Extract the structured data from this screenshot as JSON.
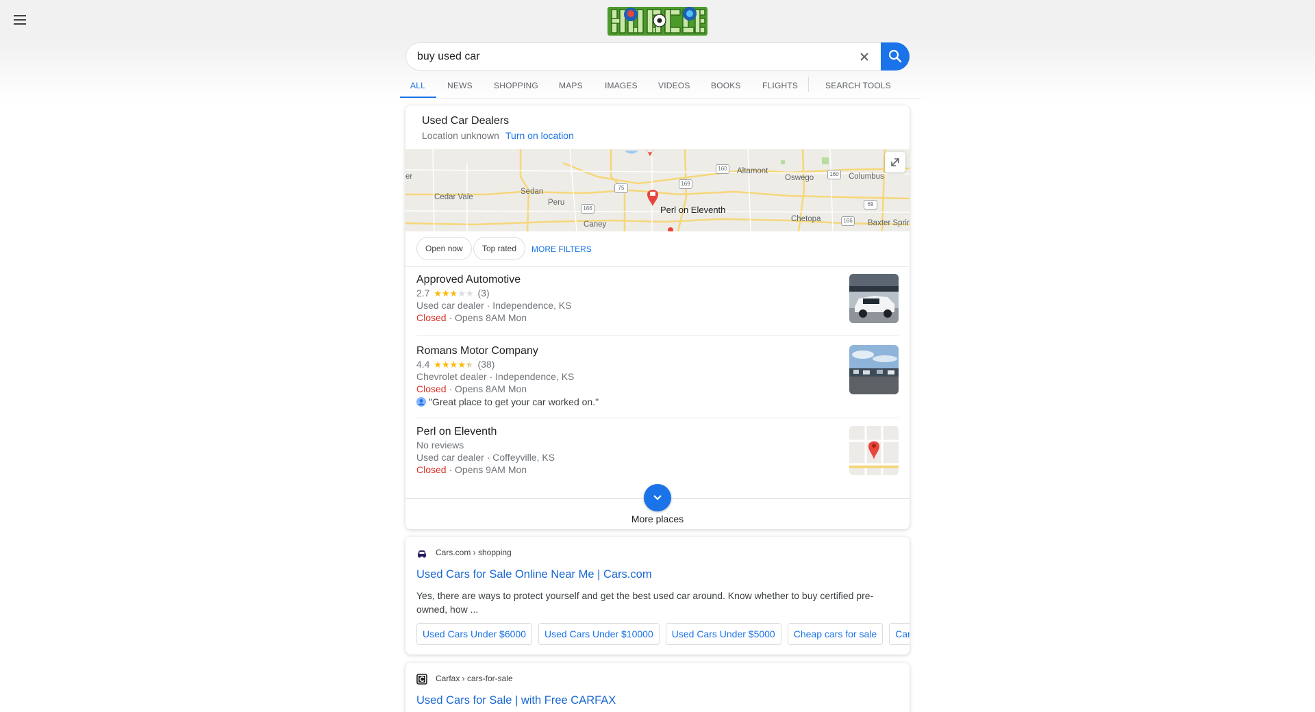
{
  "search": {
    "query": "buy used car"
  },
  "tabs": [
    "ALL",
    "NEWS",
    "SHOPPING",
    "MAPS",
    "IMAGES",
    "VIDEOS",
    "BOOKS",
    "FLIGHTS",
    "SEARCH TOOLS"
  ],
  "local": {
    "title": "Used Car Dealers",
    "location_status": "Location unknown",
    "turn_on_location": "Turn on location",
    "map_labels": [
      "Cedar Vale",
      "Sedan",
      "Peru",
      "Caney",
      "Altamont",
      "Oswego",
      "Columbus",
      "Chetopa",
      "Baxter Sprin",
      "er"
    ],
    "map_pin_label": "Perl on Eleventh",
    "highway_shields": [
      "160",
      "75",
      "169",
      "166",
      "160",
      "69",
      "166"
    ],
    "filters": {
      "open_now": "Open now",
      "top_rated": "Top rated",
      "more_filters": "MORE FILTERS"
    },
    "places": [
      {
        "name": "Approved Automotive",
        "rating": "2.7",
        "stars": 2.7,
        "reviews": "(3)",
        "category_location": "Used car dealer · Independence, KS",
        "status": "Closed",
        "hours": " · Opens 8AM Mon"
      },
      {
        "name": "Romans Motor Company",
        "rating": "4.4",
        "stars": 4.4,
        "reviews": "(38)",
        "category_location": "Chevrolet dealer · Independence, KS",
        "status": "Closed",
        "hours": " · Opens 8AM Mon",
        "review_quote": "\"Great place to get your car worked on.\""
      },
      {
        "name": "Perl on Eleventh",
        "rating_text": "No reviews",
        "category_location": "Used car dealer · Coffeyville, KS",
        "status": "Closed",
        "hours": " · Opens 9AM Mon"
      }
    ],
    "more_places": "More places"
  },
  "results": [
    {
      "breadcrumb": "Cars.com › shopping",
      "title": "Used Cars for Sale Online Near Me | Cars.com",
      "snippet": "Yes, there are ways to protect yourself and get the best used car around. Know whether to buy certified pre-owned, how ...",
      "sitelinks": [
        "Used Cars Under $6000",
        "Used Cars Under $10000",
        "Used Cars Under $5000",
        "Cheap cars for sale",
        "Car Dealers"
      ]
    },
    {
      "breadcrumb": "Carfax › cars-for-sale",
      "title": "Used Cars for Sale | with Free CARFAX"
    }
  ],
  "colors": {
    "accent": "#1a73e8",
    "closed": "#d93025",
    "star": "#fbbc04",
    "link": "#1967d2"
  }
}
